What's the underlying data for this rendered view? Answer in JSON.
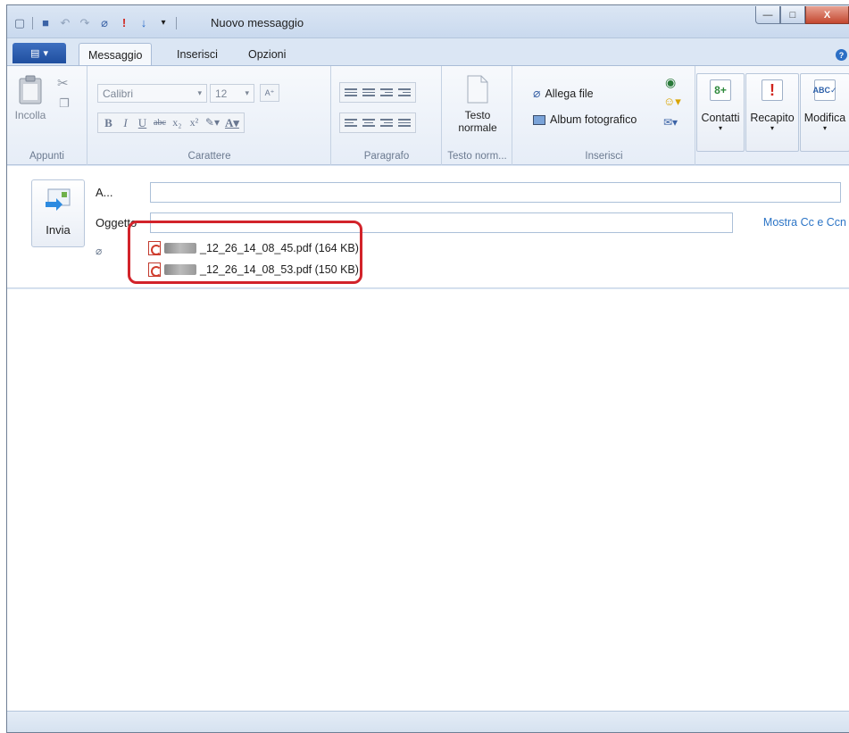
{
  "window": {
    "title": "Nuovo messaggio"
  },
  "title_bar": {
    "minimize": "—",
    "maximize": "□",
    "close": "X"
  },
  "tabs": [
    {
      "label": "Messaggio",
      "active": true
    },
    {
      "label": "Inserisci",
      "active": false
    },
    {
      "label": "Opzioni",
      "active": false
    }
  ],
  "ribbon": {
    "appunti": {
      "label": "Appunti",
      "paste": "Incolla"
    },
    "carattere": {
      "label": "Carattere",
      "font": "Calibri",
      "size": "12"
    },
    "paragrafo": {
      "label": "Paragrafo"
    },
    "testo_normale": {
      "label": "Testo norm...",
      "button": "Testo normale"
    },
    "inserisci": {
      "label": "Inserisci",
      "allega_file": "Allega file",
      "album": "Album fotografico"
    },
    "contatti": "Contatti",
    "recapito": "Recapito",
    "modifica": "Modifica"
  },
  "header": {
    "send": "Invia",
    "to_label": "A...",
    "subject_label": "Oggetto",
    "show_cc": "Mostra Cc e Ccn",
    "attachments": [
      "_12_26_14_08_45.pdf (164 KB)",
      "_12_26_14_08_53.pdf (150 KB)"
    ]
  },
  "colors": {
    "highlight": "#d2232a",
    "link": "#2b74c6",
    "accent": "#1f4f9f"
  }
}
